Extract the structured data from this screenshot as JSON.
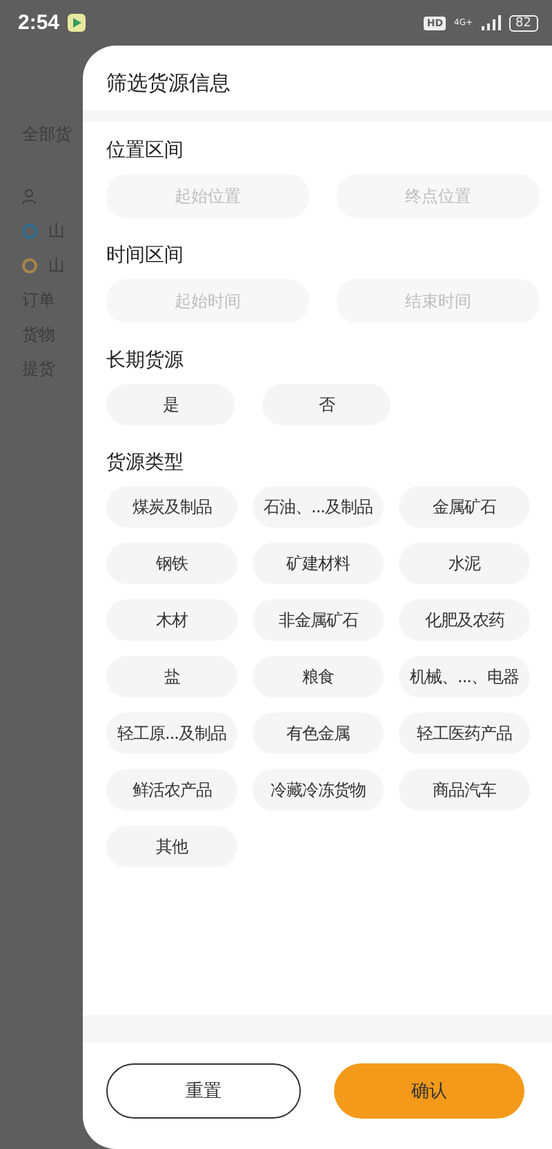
{
  "status_bar": {
    "time": "2:54",
    "hd": "HD",
    "network": "4G+",
    "battery": "82"
  },
  "background": {
    "heading": "全部货",
    "rows": [
      {
        "kind": "person",
        "text": ""
      },
      {
        "kind": "origin",
        "text": "山",
        "color": "#2f6f8f"
      },
      {
        "kind": "destination",
        "text": "山",
        "color": "#a8844a"
      },
      {
        "kind": "text",
        "text": "订单"
      },
      {
        "kind": "text",
        "text": "货物"
      },
      {
        "kind": "text",
        "text": "提货"
      }
    ]
  },
  "sheet": {
    "title": "筛选货源信息",
    "location": {
      "label": "位置区间",
      "fields": [
        {
          "placeholder": "起始位置"
        },
        {
          "placeholder": "终点位置"
        }
      ]
    },
    "time": {
      "label": "时间区间",
      "fields": [
        {
          "placeholder": "起始时间"
        },
        {
          "placeholder": "结束时间"
        }
      ]
    },
    "long_term": {
      "label": "长期货源",
      "options": [
        "是",
        "否"
      ]
    },
    "cargo_type": {
      "label": "货源类型",
      "options": [
        "煤炭及制品",
        "石油、...及制品",
        "金属矿石",
        "钢铁",
        "矿建材料",
        "水泥",
        "木材",
        "非金属矿石",
        "化肥及农药",
        "盐",
        "粮食",
        "机械、...、电器",
        "轻工原...及制品",
        "有色金属",
        "轻工医药产品",
        "鲜活农产品",
        "冷藏冷冻货物",
        "商品汽车",
        "其他"
      ]
    },
    "buttons": [
      {
        "kind": "secondary",
        "label": "重置"
      },
      {
        "kind": "primary",
        "label": "确认"
      }
    ]
  }
}
